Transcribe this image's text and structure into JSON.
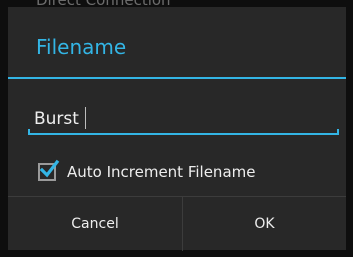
{
  "background": {
    "partial_text": "Direct Connection"
  },
  "dialog": {
    "title": "Filename",
    "accent_color": "#33b5e5",
    "filename_input": {
      "value": "Burst"
    },
    "auto_increment": {
      "label": "Auto Increment Filename",
      "checked": true
    },
    "buttons": {
      "cancel": "Cancel",
      "ok": "OK"
    }
  }
}
